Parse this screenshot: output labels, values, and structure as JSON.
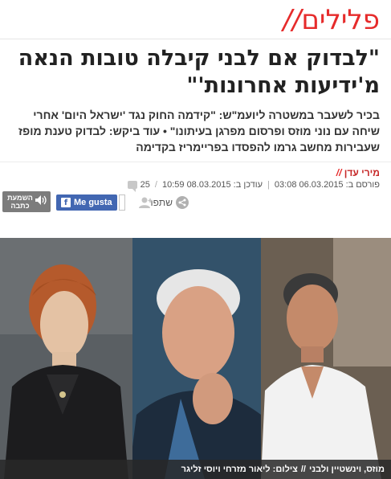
{
  "section": {
    "title": "פלילים",
    "slashes": "//"
  },
  "article": {
    "headline": "\"לבדוק אם לבני קיבלה טובות הנאה מ'ידיעות אחרונות'\"",
    "subtitle": "בכיר לשעבר במשטרה ליועמ\"ש: \"קידמה החוק נגד 'ישראל היום' אחרי שיחה עם נוני מוזס ופרסום מפרגן בעיתונו\" • עוד ביקש: לבדוק טענת מופז שעבירות מחשב גרמו להפסדו בפריימריז בקדימה",
    "author_slashes": "//",
    "author": "מירי עדן",
    "published": "פורסם ב: 06.03.2015 03:08",
    "updated": "עודכן ב: 08.03.2015 10:59",
    "comments": "25"
  },
  "share": {
    "share_label": "שתפו",
    "like_label": "Me gusta",
    "like_count": "",
    "listen_label": "השמעת כתבה"
  },
  "photo": {
    "caption": "מוזס, וינשטיין ולבני",
    "credit": "צילום: ליאור מזרחי ויוסי זליגר"
  },
  "colors": {
    "accent": "#e62b2b",
    "facebook": "#4267b2"
  }
}
